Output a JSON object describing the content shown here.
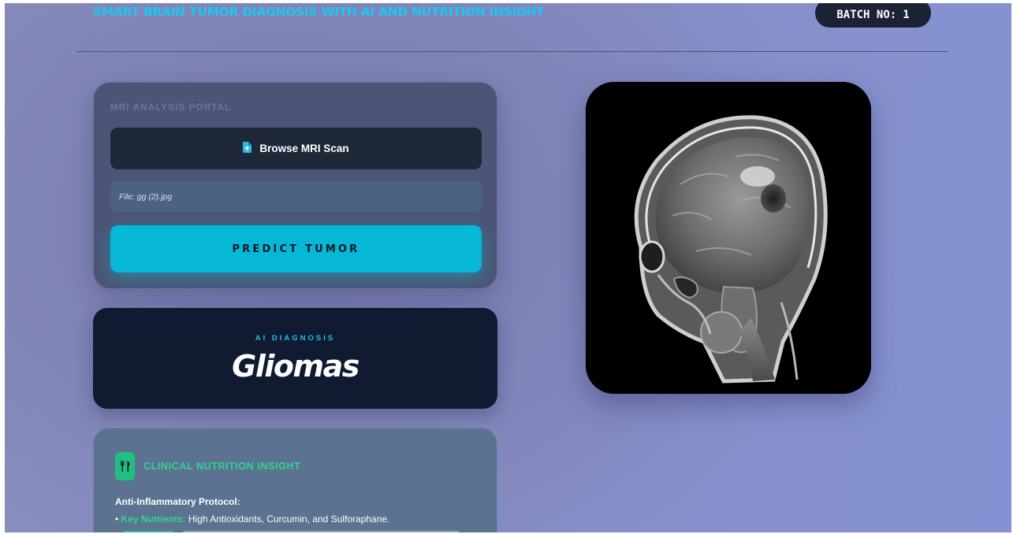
{
  "header": {
    "title": "SMART BRAIN TUMOR DIAGNOSIS WITH AI AND NUTRITION INSIGHT",
    "batch_label": "BATCH NO:",
    "batch_number": "1"
  },
  "portal": {
    "label": "MRI ANALYSIS PORTAL",
    "browse_label": "Browse MRI Scan",
    "file_status": "File: gg (2).jpg",
    "predict_label": "PREDICT TUMOR"
  },
  "diagnosis": {
    "label": "AI DIAGNOSIS",
    "result": "Gliomas"
  },
  "nutrition": {
    "title": "CLINICAL NUTRITION INSIGHT",
    "protocol_title": "Anti-Inflammatory Protocol:",
    "bullet": "•",
    "key_nutrients_label": "Key Nutrients:",
    "key_nutrients_text": "High Antioxidants, Curcumin, and Sulforaphane."
  },
  "colors": {
    "accent_cyan": "#06b8d6",
    "accent_green": "#2ed68f",
    "dark_navy": "#101a30"
  },
  "icons": {
    "browse": "file-upload-icon",
    "nutrition": "fork-knife-icon"
  }
}
